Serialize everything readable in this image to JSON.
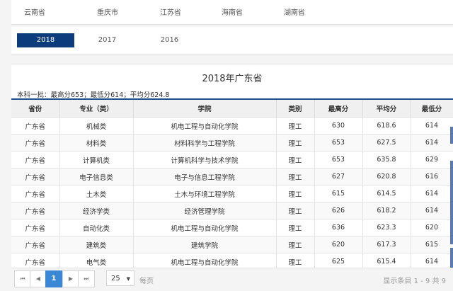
{
  "provinces": [
    "云南省",
    "重庆市",
    "江苏省",
    "海南省",
    "湖南省"
  ],
  "years": [
    "2018",
    "2017",
    "2016"
  ],
  "active_year": "2018",
  "panel": {
    "title": "2018年广东省",
    "summary": "本科一批：最高分653；最低分614；平均分624.8"
  },
  "table": {
    "headers": [
      "省份",
      "专业（类）",
      "学院",
      "类别",
      "最高分",
      "平均分",
      "最低分"
    ],
    "rows": [
      [
        "广东省",
        "机械类",
        "机电工程与自动化学院",
        "理工",
        "630",
        "618.6",
        "614"
      ],
      [
        "广东省",
        "材料类",
        "材料科学与工程学院",
        "理工",
        "653",
        "627.5",
        "614"
      ],
      [
        "广东省",
        "计算机类",
        "计算机科学与技术学院",
        "理工",
        "653",
        "635.8",
        "629"
      ],
      [
        "广东省",
        "电子信息类",
        "电子与信息工程学院",
        "理工",
        "627",
        "620.8",
        "616"
      ],
      [
        "广东省",
        "土木类",
        "土木与环境工程学院",
        "理工",
        "615",
        "614.5",
        "614"
      ],
      [
        "广东省",
        "经济学类",
        "经济管理学院",
        "理工",
        "626",
        "618.2",
        "614"
      ],
      [
        "广东省",
        "自动化类",
        "机电工程与自动化学院",
        "理工",
        "636",
        "623.3",
        "620"
      ],
      [
        "广东省",
        "建筑类",
        "建筑学院",
        "理工",
        "620",
        "617.3",
        "615"
      ],
      [
        "广东省",
        "电气类",
        "机电工程与自动化学院",
        "理工",
        "625",
        "615.4",
        "614"
      ]
    ]
  },
  "pager": {
    "first": "⏮",
    "prev": "◀",
    "current_page": "1",
    "next": "▶",
    "last": "⏭",
    "page_size": "25",
    "per_page_label": "每页",
    "info": "显示条目 1 - 9 共 9"
  }
}
